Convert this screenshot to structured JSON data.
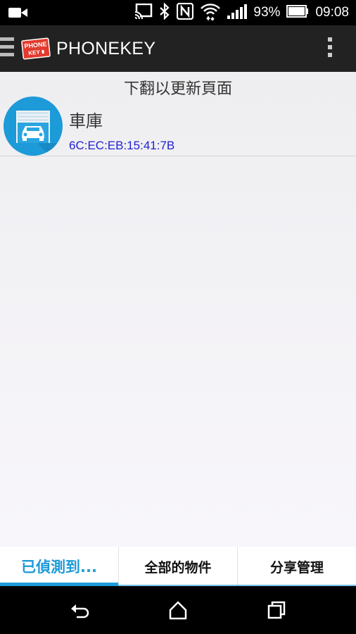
{
  "status_bar": {
    "battery_percent": "93%",
    "time": "09:08",
    "icons": [
      "video-camera-icon",
      "cast-icon",
      "bluetooth-icon",
      "nfc-icon",
      "wifi-icon",
      "signal-icon",
      "battery-icon"
    ]
  },
  "app_bar": {
    "logo_text_top": "PHONE",
    "logo_text_bottom": "KEY",
    "title": "PHONEKEY",
    "icons": [
      "drawer-menu-icon",
      "overflow-menu-icon"
    ]
  },
  "content": {
    "pull_hint": "下翻以更新頁面",
    "devices": [
      {
        "name": "車庫",
        "mac": "6C:EC:EB:15:41:7B",
        "icon": "garage-car-icon"
      }
    ]
  },
  "tabs": [
    {
      "label": "已偵測到...",
      "active": true
    },
    {
      "label": "全部的物件",
      "active": false
    },
    {
      "label": "分享管理",
      "active": false
    }
  ],
  "nav_bar": {
    "icons": [
      "back-icon",
      "home-icon",
      "recents-icon"
    ]
  },
  "colors": {
    "accent": "#1d9ad8",
    "mac_text": "#1f1fd2",
    "app_bar": "#222222"
  }
}
